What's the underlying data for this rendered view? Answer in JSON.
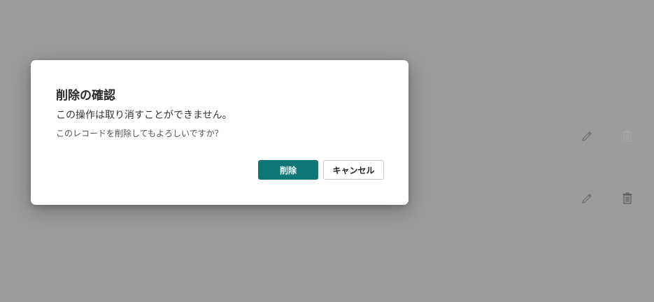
{
  "dialog": {
    "title": "削除の確認",
    "message": "この操作は取り消すことができません。",
    "submessage": "このレコードを削除してもよろしいですか？",
    "delete_label": "削除",
    "cancel_label": "キャンセル"
  },
  "background": {
    "rows": [
      {
        "actions": [
          "edit-icon",
          "trash-icon"
        ]
      },
      {
        "actions": [
          "edit-icon",
          "trash-icon"
        ]
      }
    ]
  },
  "colors": {
    "overlay": "#9c9c9c",
    "primary": "#0f7777",
    "dialog_bg": "#ffffff"
  }
}
